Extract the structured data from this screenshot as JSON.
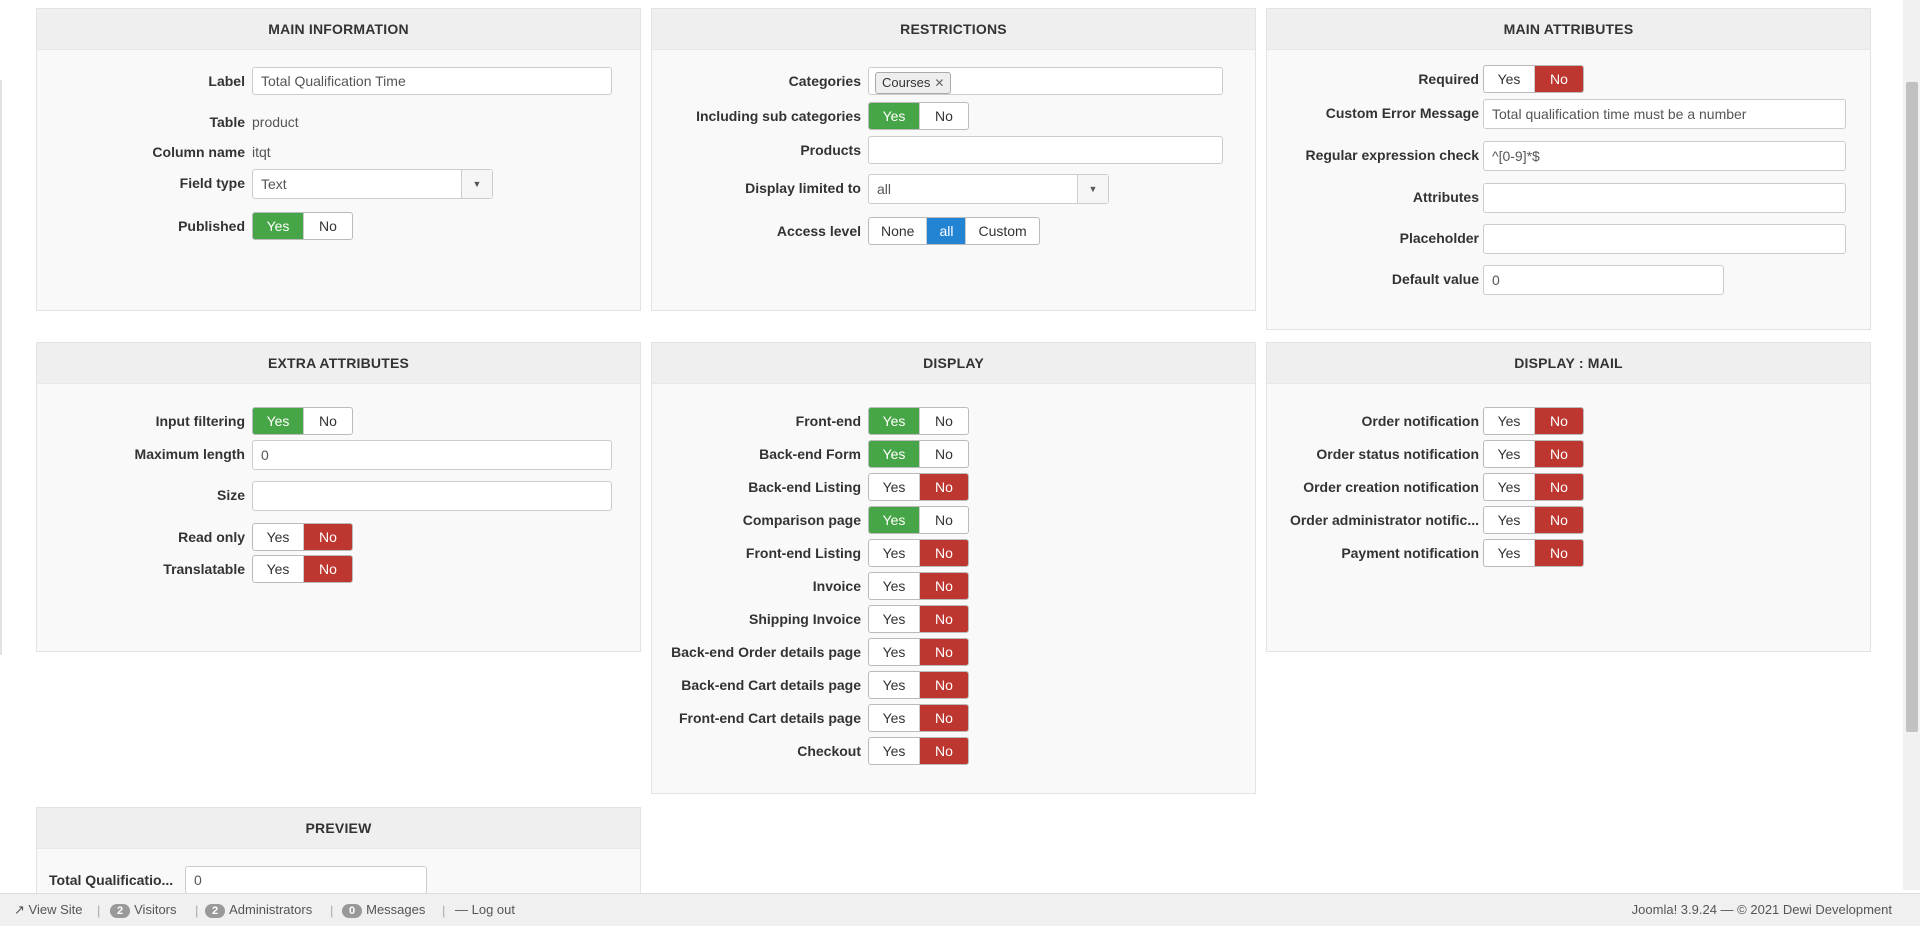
{
  "main_information": {
    "title": "MAIN INFORMATION",
    "label_label": "Label",
    "label_value": "Total Qualification Time",
    "table_label": "Table",
    "table_value": "product",
    "column_label": "Column name",
    "column_value": "itqt",
    "fieldtype_label": "Field type",
    "fieldtype_value": "Text",
    "published_label": "Published",
    "yes": "Yes",
    "no": "No"
  },
  "restrictions": {
    "title": "RESTRICTIONS",
    "categories_label": "Categories",
    "category_chip": "Courses",
    "subcat_label": "Including sub categories",
    "products_label": "Products",
    "display_limited_label": "Display limited to",
    "display_limited_value": "all",
    "access_label": "Access level",
    "access_none": "None",
    "access_all": "all",
    "access_custom": "Custom",
    "yes": "Yes",
    "no": "No"
  },
  "main_attributes": {
    "title": "MAIN ATTRIBUTES",
    "required_label": "Required",
    "custom_error_label": "Custom Error Message",
    "custom_error_value": "Total qualification time must be a number",
    "regex_label": "Regular expression check",
    "regex_value": "^[0-9]*$",
    "attributes_label": "Attributes",
    "placeholder_label": "Placeholder",
    "default_label": "Default value",
    "default_value": "0",
    "yes": "Yes",
    "no": "No"
  },
  "extra_attributes": {
    "title": "EXTRA ATTRIBUTES",
    "input_filtering_label": "Input filtering",
    "max_length_label": "Maximum length",
    "max_length_value": "0",
    "size_label": "Size",
    "readonly_label": "Read only",
    "translatable_label": "Translatable",
    "yes": "Yes",
    "no": "No"
  },
  "display": {
    "title": "DISPLAY",
    "yes": "Yes",
    "no": "No",
    "rows": [
      {
        "label": "Front-end",
        "state": "yes"
      },
      {
        "label": "Back-end Form",
        "state": "yes"
      },
      {
        "label": "Back-end Listing",
        "state": "no"
      },
      {
        "label": "Comparison page",
        "state": "yes"
      },
      {
        "label": "Front-end Listing",
        "state": "no"
      },
      {
        "label": "Invoice",
        "state": "no"
      },
      {
        "label": "Shipping Invoice",
        "state": "no"
      },
      {
        "label": "Back-end Order details page",
        "state": "no"
      },
      {
        "label": "Back-end Cart details page",
        "state": "no"
      },
      {
        "label": "Front-end Cart details page",
        "state": "no"
      },
      {
        "label": "Checkout",
        "state": "no"
      }
    ]
  },
  "display_mail": {
    "title": "DISPLAY : MAIL",
    "yes": "Yes",
    "no": "No",
    "rows": [
      {
        "label": "Order notification",
        "state": "no"
      },
      {
        "label": "Order status notification",
        "state": "no"
      },
      {
        "label": "Order creation notification",
        "state": "no"
      },
      {
        "label": "Order administrator notific...",
        "state": "no"
      },
      {
        "label": "Payment notification",
        "state": "no"
      }
    ]
  },
  "preview": {
    "title": "PREVIEW",
    "field_label": "Total Qualificatio...",
    "field_value": "0"
  },
  "status_bar": {
    "view_site": "View Site",
    "visitors_count": "2",
    "visitors": "Visitors",
    "admins_count": "2",
    "admins": "Administrators",
    "messages_count": "0",
    "messages": "Messages",
    "logout": "Log out",
    "copyright": "Joomla! 3.9.24 — © 2021 Dewi Development"
  },
  "colors": {
    "green": "#46a546",
    "red": "#bd362f",
    "blue": "#2384d3"
  }
}
